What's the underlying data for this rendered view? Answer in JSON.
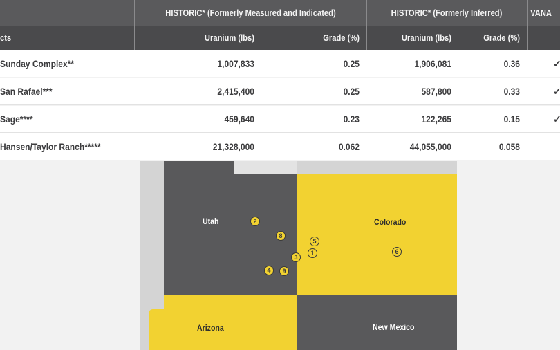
{
  "table": {
    "group_headers": {
      "measured": "HISTORIC* (Formerly Measured and Indicated)",
      "inferred": "HISTORIC* (Formerly Inferred)",
      "vanadium": "VANA"
    },
    "column_headers": {
      "project": "cts",
      "m_uranium": "Uranium (lbs)",
      "m_grade": "Grade (%)",
      "i_uranium": "Uranium (lbs)",
      "i_grade": "Grade (%)"
    },
    "rows": [
      {
        "project": "Sunday Complex**",
        "m_uranium": "1,007,833",
        "m_grade": "0.25",
        "i_uranium": "1,906,081",
        "i_grade": "0.36",
        "vanadium": "✓"
      },
      {
        "project": "San Rafael***",
        "m_uranium": "2,415,400",
        "m_grade": "0.25",
        "i_uranium": "587,800",
        "i_grade": "0.33",
        "vanadium": "✓"
      },
      {
        "project": "Sage****",
        "m_uranium": "459,640",
        "m_grade": "0.23",
        "i_uranium": "122,265",
        "i_grade": "0.15",
        "vanadium": "✓"
      },
      {
        "project": "Hansen/Taylor Ranch*****",
        "m_uranium": "21,328,000",
        "m_grade": "0.062",
        "i_uranium": "44,055,000",
        "i_grade": "0.058",
        "vanadium": ""
      }
    ]
  },
  "map": {
    "states": {
      "utah": "Utah",
      "colorado": "Colorado",
      "arizona": "Arizona",
      "new_mexico": "New Mexico"
    },
    "markers": [
      "2",
      "8",
      "7",
      "5",
      "3",
      "1",
      "6",
      "4",
      "9"
    ],
    "colors": {
      "dark": "#59595b",
      "yellow": "#f2d231",
      "outside": "#d4d4d4"
    }
  }
}
